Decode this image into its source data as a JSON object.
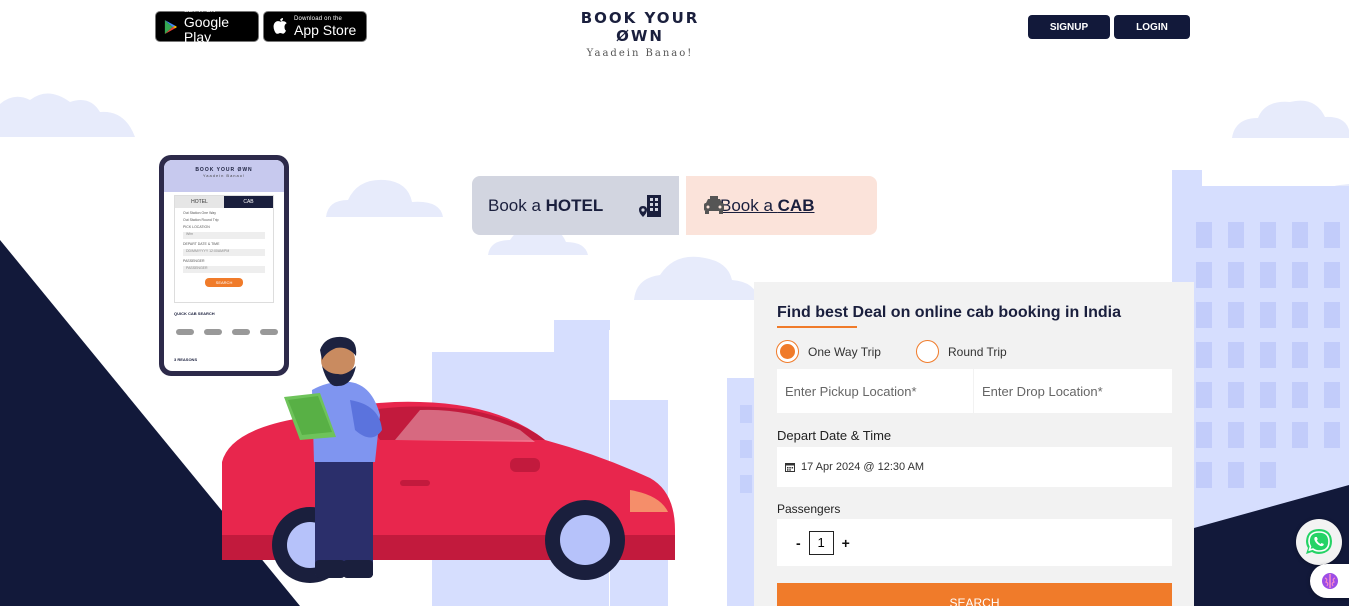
{
  "header": {
    "google_play": {
      "small": "GET IT ON",
      "big": "Google Play"
    },
    "app_store": {
      "small": "Download on the",
      "big": "App Store"
    },
    "logo_title": "BOOK YOUR ØWN",
    "logo_tagline": "Yaadein Banao!",
    "signup_label": "SIGNUP",
    "login_label": "LOGIN"
  },
  "tabs": {
    "hotel": {
      "prefix": "Book a ",
      "bold": "HOTEL"
    },
    "cab": {
      "prefix": "Book a ",
      "bold": "CAB"
    }
  },
  "form": {
    "title": "Find best Deal on online cab booking in India",
    "trip_types": [
      {
        "label": "One Way Trip",
        "selected": true
      },
      {
        "label": "Round Trip",
        "selected": false
      }
    ],
    "pickup_placeholder": "Enter Pickup Location*",
    "drop_placeholder": "Enter Drop Location*",
    "depart_label": "Depart Date & Time",
    "depart_value": "17 Apr 2024 @ 12:30 AM",
    "passengers_label": "Passengers",
    "passengers_minus": "-",
    "passengers_value": "1",
    "passengers_plus": "+",
    "search_label": "SEARCH"
  },
  "phone_mockup": {
    "logo": "BOOK YOUR ØWN",
    "tagline": "Yaadein Banao!",
    "tab_hotel": "HOTEL",
    "tab_cab": "CAB",
    "option1": "Out Station One Way",
    "option2": "Out Station Round Trip",
    "pickup_label": "PICK LOCATION",
    "field1": "Wfm",
    "date_label": "DEPART DATE & TIME",
    "field2": "DD/MM/YYYY 12:00AM/PM",
    "passenger_label": "PASSENGER",
    "field3": "PASSENGER",
    "search": "SEARCH",
    "quick_search": "QUICK CAB SEARCH",
    "reasons": "3 REASONS"
  },
  "colors": {
    "navy": "#12193a",
    "accent_orange": "#f07b2a",
    "hotel_tab": "#d2d5e0",
    "cab_tab": "#fbe3da",
    "car_red": "#e8264d",
    "building_blue": "#d6defe"
  }
}
